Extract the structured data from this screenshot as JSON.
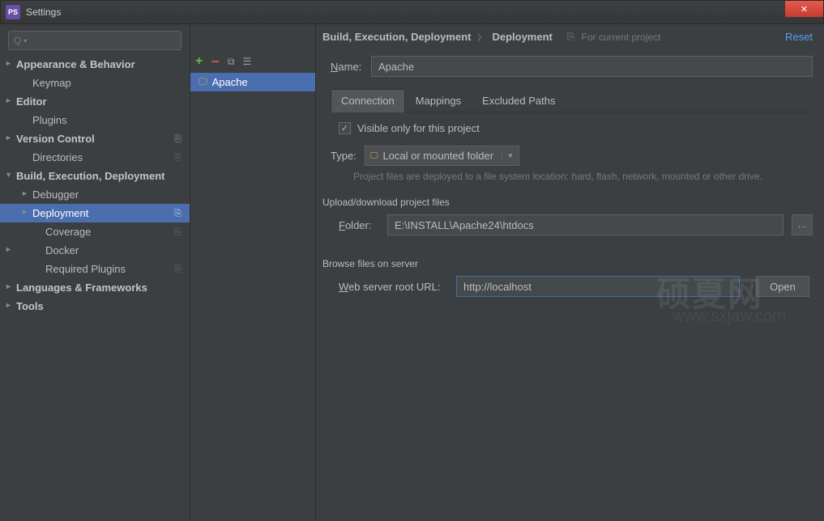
{
  "window": {
    "title": "Settings",
    "app_abbr": "PS"
  },
  "sidebar": {
    "search_placeholder": "",
    "items": [
      {
        "label": "Appearance & Behavior",
        "bold": true,
        "arrow": "►"
      },
      {
        "label": "Keymap",
        "sub": true
      },
      {
        "label": "Editor",
        "bold": true,
        "arrow": "►"
      },
      {
        "label": "Plugins",
        "sub": true
      },
      {
        "label": "Version Control",
        "bold": true,
        "arrow": "►",
        "badge": "⎘"
      },
      {
        "label": "Directories",
        "sub": true,
        "badge": "⎘"
      },
      {
        "label": "Build, Execution, Deployment",
        "bold": true,
        "arrow": "▼"
      },
      {
        "label": "Debugger",
        "sub": true,
        "arrow": "►"
      },
      {
        "label": "Deployment",
        "sub": true,
        "arrow": "►",
        "selected": true,
        "badge": "⎘"
      },
      {
        "label": "Coverage",
        "subsub": true,
        "badge": "⎘"
      },
      {
        "label": "Docker",
        "subsub": true,
        "arrow": "►"
      },
      {
        "label": "Required Plugins",
        "subsub": true,
        "badge": "⎘"
      },
      {
        "label": "Languages & Frameworks",
        "bold": true,
        "arrow": "►"
      },
      {
        "label": "Tools",
        "bold": true,
        "arrow": "►"
      }
    ]
  },
  "breadcrumb": {
    "parent": "Build, Execution, Deployment",
    "current": "Deployment",
    "project_hint": "For current project",
    "reset": "Reset"
  },
  "servers": {
    "selected": {
      "label": "Apache"
    }
  },
  "form": {
    "name_label": "Name:",
    "name_value": "Apache",
    "tabs": {
      "connection": "Connection",
      "mappings": "Mappings",
      "excluded": "Excluded Paths"
    },
    "visible_checkbox": "Visible only for this project",
    "type_label": "Type:",
    "type_value": "Local or mounted folder",
    "type_hint": "Project files are deployed to a file system location: hard, flash, network, mounted or other drive.",
    "upload_section": "Upload/download project files",
    "folder_label": "Folder:",
    "folder_value": "E:\\INSTALL\\Apache24\\htdocs",
    "browse_section": "Browse files on server",
    "url_label_pre": "W",
    "url_label_rest": "eb server root URL:",
    "url_value": "http://localhost",
    "open_button": "Open"
  },
  "watermark": {
    "main": "硕夏网",
    "sub": "www.sxjaw.com"
  }
}
